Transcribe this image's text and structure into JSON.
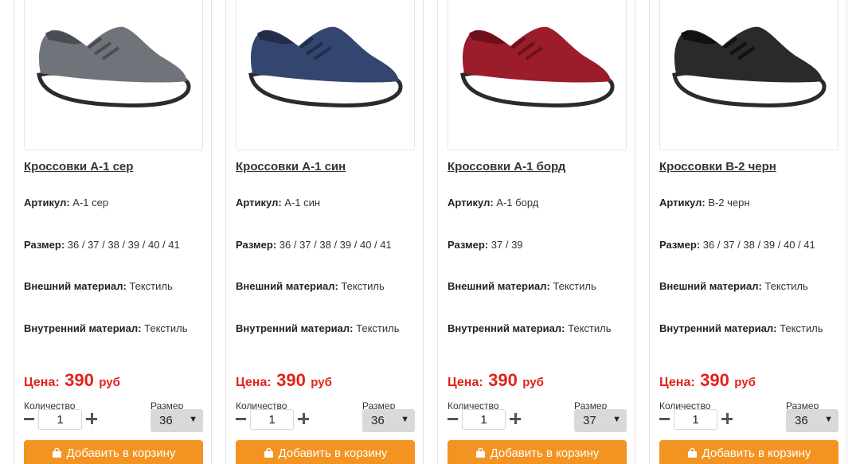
{
  "labels": {
    "article": "Артикул:",
    "size": "Размер:",
    "outer": "Внешний материал:",
    "inner": "Внутренний материал:",
    "price": "Цена:",
    "currency": "руб",
    "quantity": "Количество",
    "size_select": "Размер",
    "add_to_cart": "Добавить в корзину"
  },
  "products": [
    {
      "title": "Кроссовки А-1 сер",
      "article": "А-1 сер",
      "sizes": "36 / 37 / 38 / 39 / 40 / 41",
      "outer": "Текстиль",
      "inner": "Текстиль",
      "price": "390",
      "qty": "1",
      "size_selected": "36",
      "shoe_color": "#6f747b",
      "shoe_dark": "#4a4e54"
    },
    {
      "title": "Кроссовки А-1 син",
      "article": "А-1 син",
      "sizes": "36 / 37 / 38 / 39 / 40 / 41",
      "outer": "Текстиль",
      "inner": "Текстиль",
      "price": "390",
      "qty": "1",
      "size_selected": "36",
      "shoe_color": "#34466f",
      "shoe_dark": "#222d4a"
    },
    {
      "title": "Кроссовки А-1 борд",
      "article": "А-1 борд",
      "sizes": "37 / 39",
      "outer": "Текстиль",
      "inner": "Текстиль",
      "price": "390",
      "qty": "1",
      "size_selected": "37",
      "shoe_color": "#9b1c2a",
      "shoe_dark": "#6d0f1b"
    },
    {
      "title": "Кроссовки В-2 черн",
      "article": "В-2 черн",
      "sizes": "36 / 37 / 38 / 39 / 40 / 41",
      "outer": "Текстиль",
      "inner": "Текстиль",
      "price": "390",
      "qty": "1",
      "size_selected": "36",
      "shoe_color": "#2a2a2a",
      "shoe_dark": "#111111"
    }
  ]
}
